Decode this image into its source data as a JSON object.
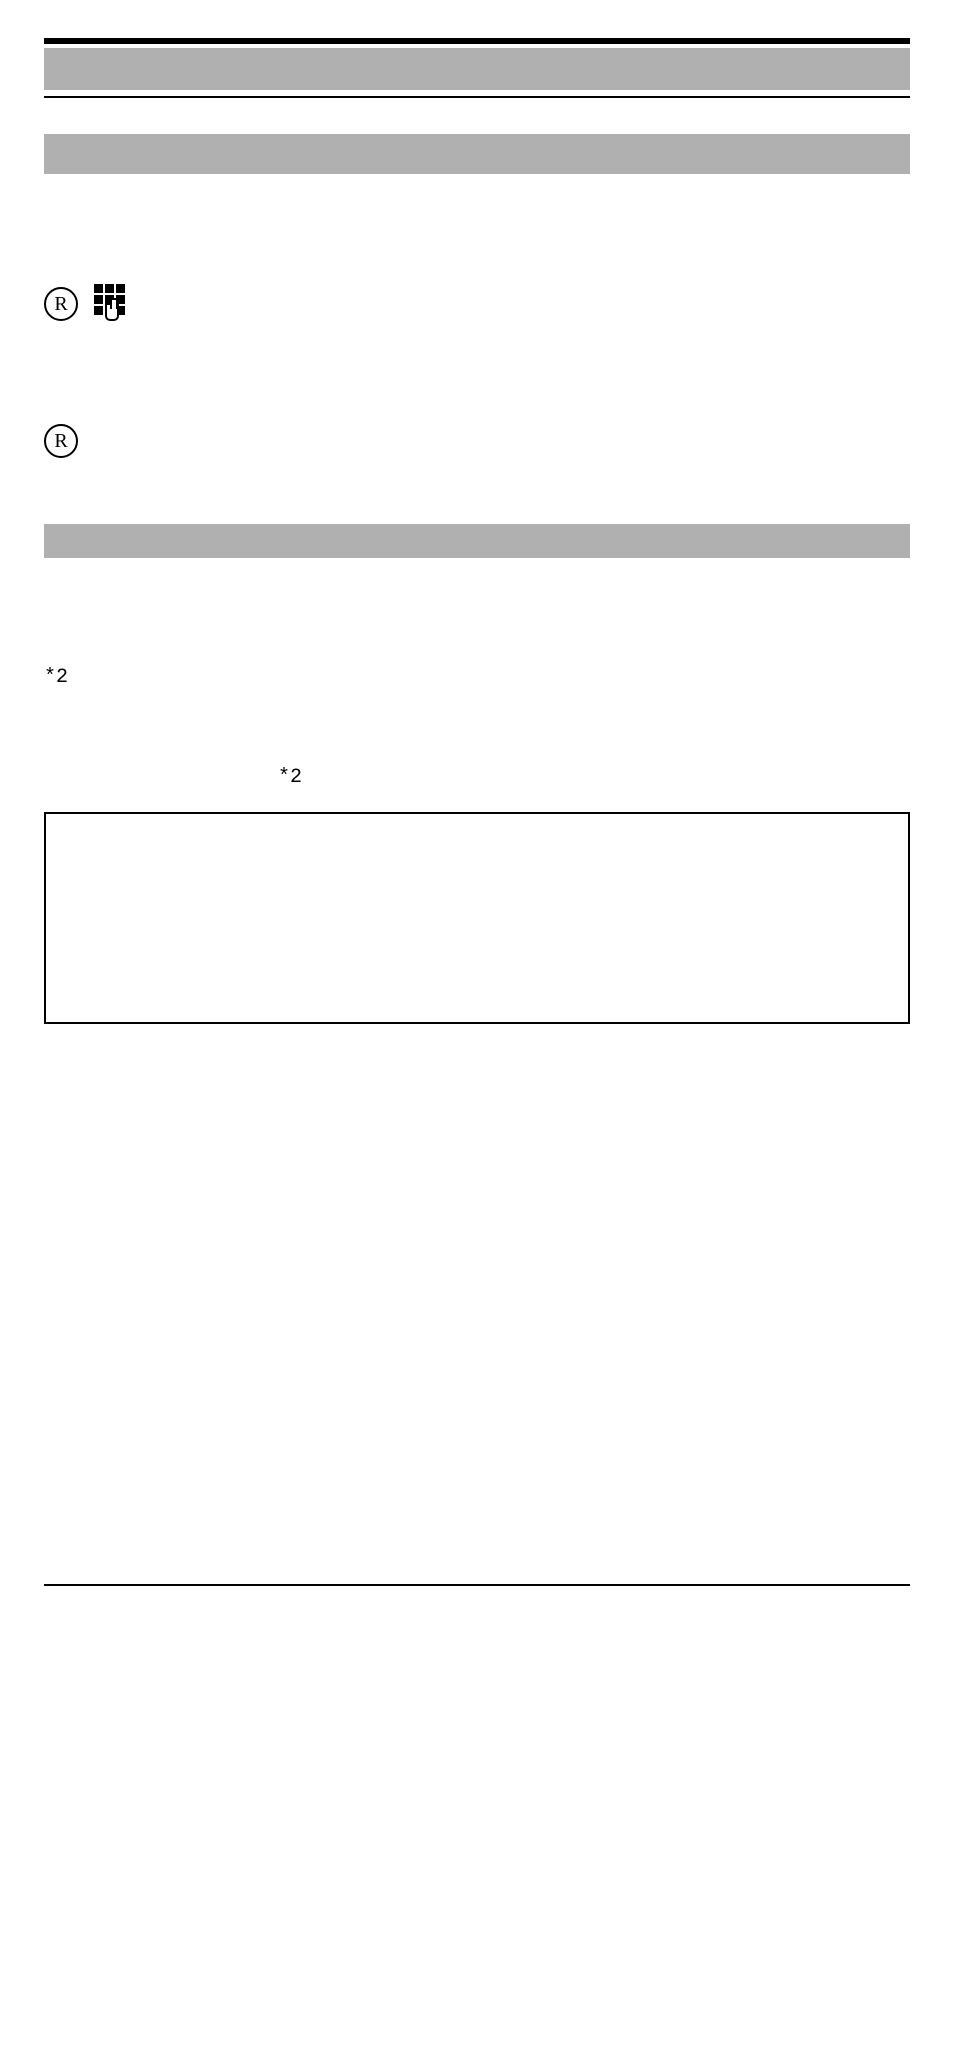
{
  "marker1": "*2",
  "marker2": "*2",
  "circled": "R"
}
